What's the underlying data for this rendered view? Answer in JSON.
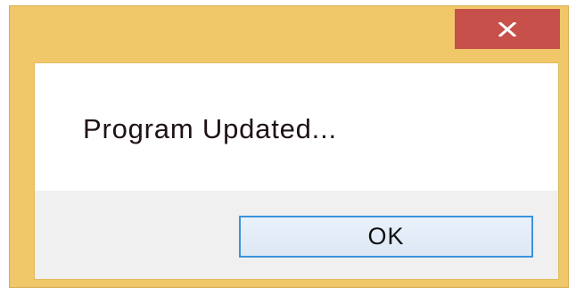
{
  "dialog": {
    "message": "Program Updated...",
    "ok_label": "OK",
    "close_glyph": "close-icon"
  },
  "colors": {
    "frame": "#f0c86a",
    "close_button": "#c7504b",
    "content_bg": "#ffffff",
    "button_area_bg": "#f0f0f0",
    "ok_border": "#3c93dc",
    "text": "#1e1218"
  }
}
